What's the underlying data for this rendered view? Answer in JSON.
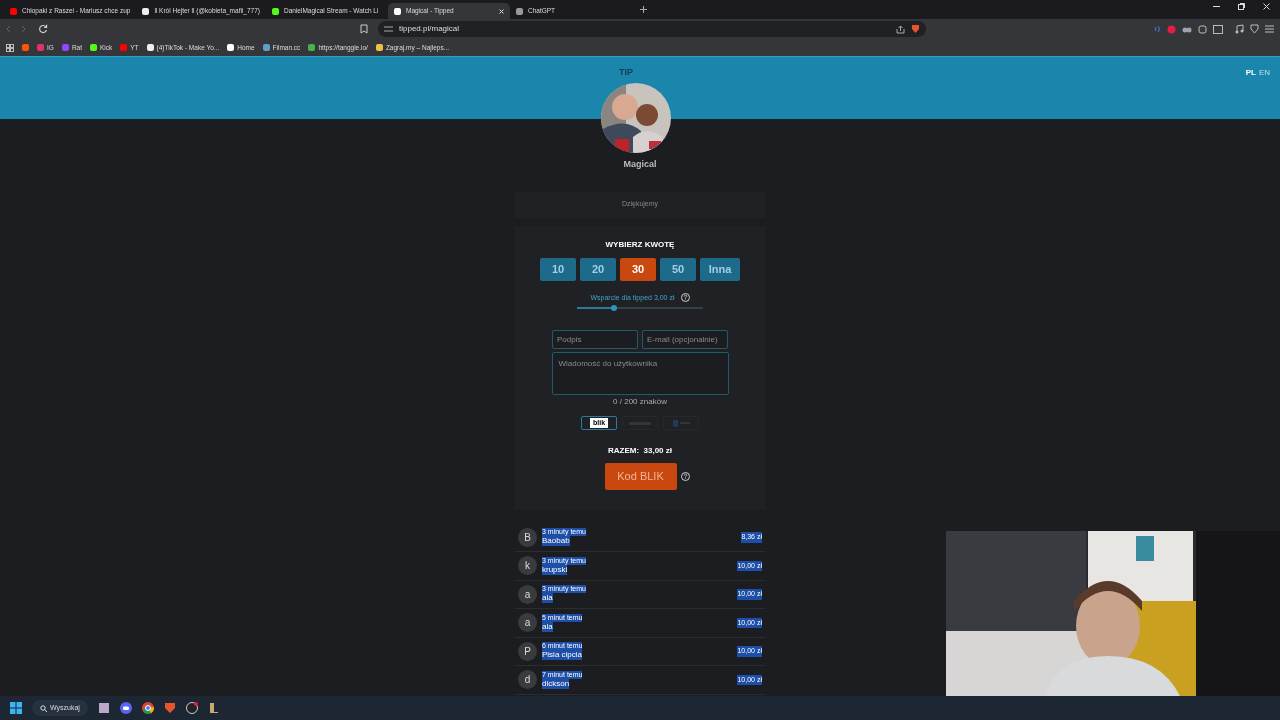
{
  "tabs": [
    {
      "title": "Chłopaki z Raszei - Mariusz chce zup",
      "kind": "youtube",
      "selected": false
    },
    {
      "title": "ll Król Hejter ll (@kobieta_mafii_777)",
      "kind": "tiktok",
      "selected": false
    },
    {
      "title": "DanielMagical Stream - Watch Li",
      "kind": "kick",
      "selected": false
    },
    {
      "title": "Magical - Tipped",
      "kind": "tipped",
      "selected": true
    },
    {
      "title": "ChatGPT",
      "kind": "chatgpt",
      "selected": false
    }
  ],
  "address_bar": {
    "url": "tipped.pl/magical"
  },
  "bookmarks": [
    {
      "kind": "soundcloud"
    },
    {
      "label": "IG",
      "kind": "instagram"
    },
    {
      "label": "Rat",
      "kind": "twitch"
    },
    {
      "label": "Kick",
      "kind": "kick"
    },
    {
      "label": "YT",
      "kind": "youtube"
    },
    {
      "label": "(4)TikTok - Make Yo...",
      "kind": "tiktok"
    },
    {
      "label": "Home",
      "kind": "x"
    },
    {
      "label": "Filman.cc",
      "kind": "globe"
    },
    {
      "label": "https://tanggle.io/",
      "kind": "leaf"
    },
    {
      "label": "Zagraj.my – Najleps...",
      "kind": "person"
    }
  ],
  "page": {
    "logo": "TIP",
    "languages": [
      {
        "label": "PL",
        "selected": true
      },
      {
        "label": "EN",
        "selected": false
      }
    ],
    "profile_name": "Magical",
    "thanks": "Dziękujemy",
    "amount_title": "WYBIERZ KWOTĘ",
    "amounts": [
      {
        "label": "10",
        "selected": false
      },
      {
        "label": "20",
        "selected": false
      },
      {
        "label": "30",
        "selected": true
      },
      {
        "label": "50",
        "selected": false
      },
      {
        "label": "Inna",
        "selected": false
      }
    ],
    "support": {
      "label": "Wsparcie dla tipped 3,00 zł",
      "level": 0.29
    },
    "signature_field": {
      "placeholder": "Podpis"
    },
    "email_field": {
      "placeholder": "E-mail (opcjonalnie)"
    },
    "message_field": {
      "placeholder": "Wiadomość do użytkownika"
    },
    "char_count": "0 / 200 znaków",
    "payment_methods": [
      {
        "kind": "blik",
        "label": "blik",
        "selected": true
      },
      {
        "kind": "transfer",
        "selected": false
      },
      {
        "kind": "paypal",
        "selected": false
      }
    ],
    "total": "RAZEM:  33,00 zł",
    "pay_button": "Kod BLIK",
    "donations": [
      {
        "initial": "B",
        "time": "3 minuty temu",
        "name": "Baobab",
        "amount": "8,36 zł"
      },
      {
        "initial": "k",
        "time": "3 minuty temu",
        "name": "krupski",
        "amount": "10,00 zł"
      },
      {
        "initial": "a",
        "time": "3 minuty temu",
        "name": "ala",
        "amount": "10,00 zł"
      },
      {
        "initial": "a",
        "time": "5 minut temu",
        "name": "ala",
        "amount": "10,00 zł"
      },
      {
        "initial": "P",
        "time": "6 minut temu",
        "name": "Pisia cipcia",
        "amount": "10,00 zł"
      },
      {
        "initial": "d",
        "time": "7 minut temu",
        "name": "dickson",
        "amount": "10,00 zł"
      }
    ]
  },
  "taskbar": {
    "search": "Wyszukaj"
  }
}
